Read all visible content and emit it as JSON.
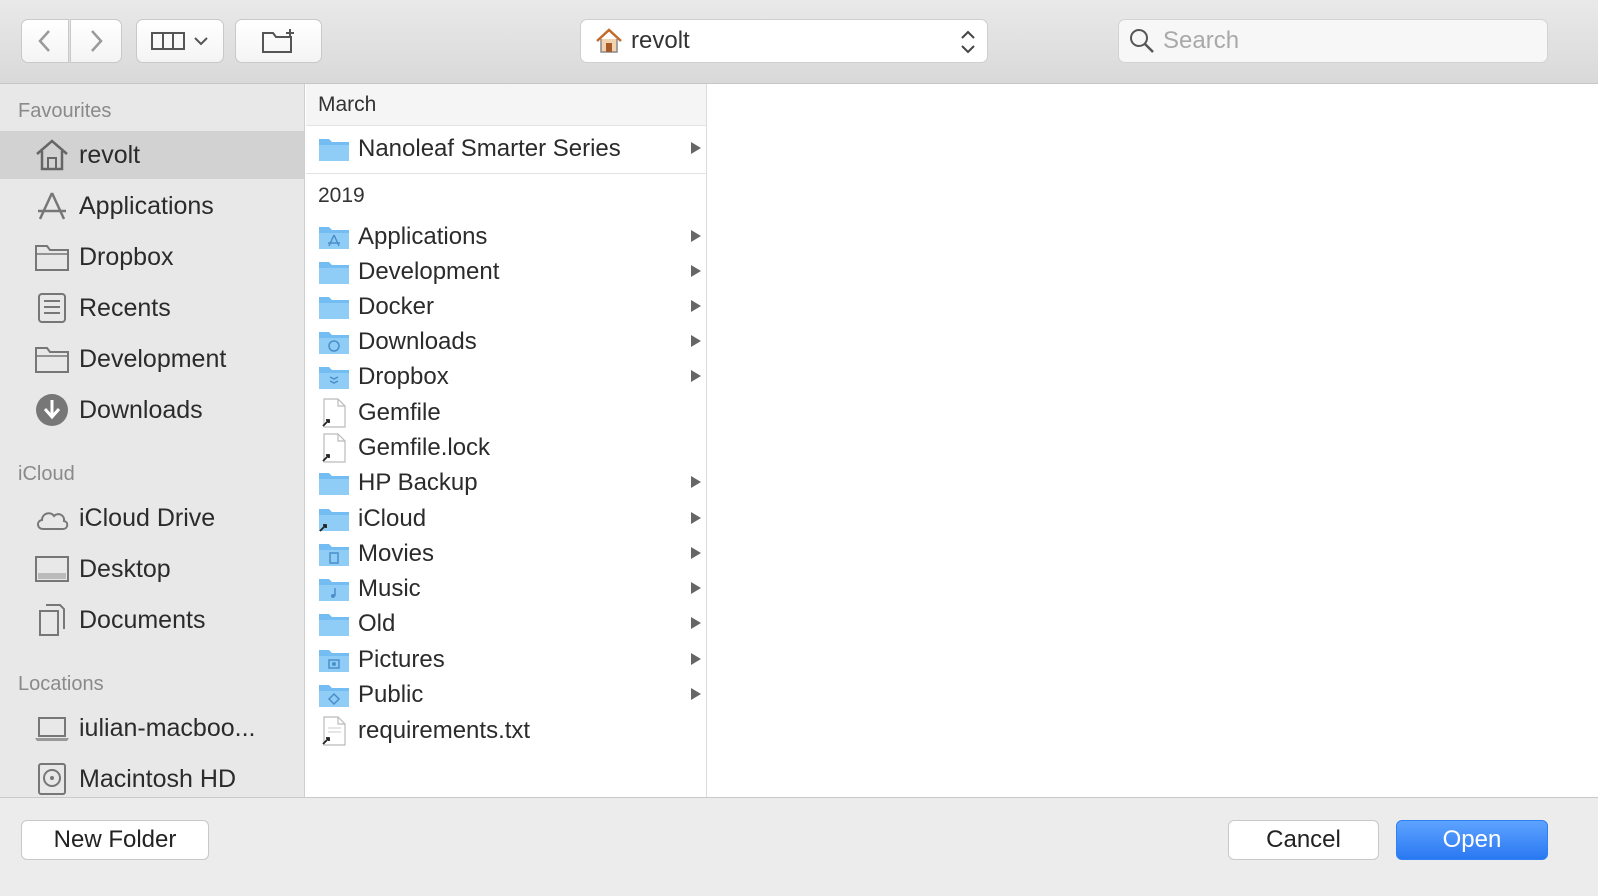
{
  "toolbar": {
    "back_icon": "chevron-left-icon",
    "forward_icon": "chevron-right-icon",
    "view_icon": "columns-view-icon",
    "new_folder_icon": "new-folder-icon",
    "location": {
      "icon": "home-icon",
      "label": "revolt"
    },
    "search": {
      "placeholder": "Search",
      "value": ""
    }
  },
  "sidebar": {
    "sections": [
      {
        "title": "Favourites",
        "items": [
          {
            "label": "revolt",
            "icon": "home-icon",
            "selected": true
          },
          {
            "label": "Applications",
            "icon": "applications-icon"
          },
          {
            "label": "Dropbox",
            "icon": "folder-icon"
          },
          {
            "label": "Recents",
            "icon": "recents-icon"
          },
          {
            "label": "Development",
            "icon": "folder-icon"
          },
          {
            "label": "Downloads",
            "icon": "downloads-icon"
          }
        ]
      },
      {
        "title": "iCloud",
        "items": [
          {
            "label": "iCloud Drive",
            "icon": "cloud-icon"
          },
          {
            "label": "Desktop",
            "icon": "desktop-icon"
          },
          {
            "label": "Documents",
            "icon": "documents-icon"
          }
        ]
      },
      {
        "title": "Locations",
        "items": [
          {
            "label": "iulian-macboo...",
            "icon": "laptop-icon"
          },
          {
            "label": "Macintosh HD",
            "icon": "hard-drive-icon"
          }
        ]
      }
    ]
  },
  "browser": {
    "groups": [
      {
        "title": "March",
        "items": [
          {
            "label": "Nanoleaf Smarter Series",
            "kind": "folder",
            "arrow": true
          }
        ]
      },
      {
        "title": "2019",
        "items": [
          {
            "label": "Applications",
            "kind": "folder-apps",
            "arrow": true
          },
          {
            "label": "Development",
            "kind": "folder",
            "arrow": true
          },
          {
            "label": "Docker",
            "kind": "folder",
            "arrow": true
          },
          {
            "label": "Downloads",
            "kind": "folder-downloads",
            "arrow": true
          },
          {
            "label": "Dropbox",
            "kind": "folder-dropbox",
            "arrow": true
          },
          {
            "label": "Gemfile",
            "kind": "file-alias",
            "arrow": false
          },
          {
            "label": "Gemfile.lock",
            "kind": "file-alias",
            "arrow": false
          },
          {
            "label": "HP Backup",
            "kind": "folder",
            "arrow": true
          },
          {
            "label": "iCloud",
            "kind": "folder-alias",
            "arrow": true
          },
          {
            "label": "Movies",
            "kind": "folder-movies",
            "arrow": true
          },
          {
            "label": "Music",
            "kind": "folder-music",
            "arrow": true
          },
          {
            "label": "Old",
            "kind": "folder",
            "arrow": true
          },
          {
            "label": "Pictures",
            "kind": "folder-pictures",
            "arrow": true
          },
          {
            "label": "Public",
            "kind": "folder-public",
            "arrow": true
          },
          {
            "label": "requirements.txt",
            "kind": "file-alias",
            "arrow": false
          }
        ]
      }
    ]
  },
  "footer": {
    "new_folder_label": "New Folder",
    "cancel_label": "Cancel",
    "open_label": "Open"
  },
  "colors": {
    "accent": "#2a78f2",
    "folder": "#74bdf2",
    "sidebar_bg": "#e8e8e8",
    "selection": "#d2d2d2"
  }
}
